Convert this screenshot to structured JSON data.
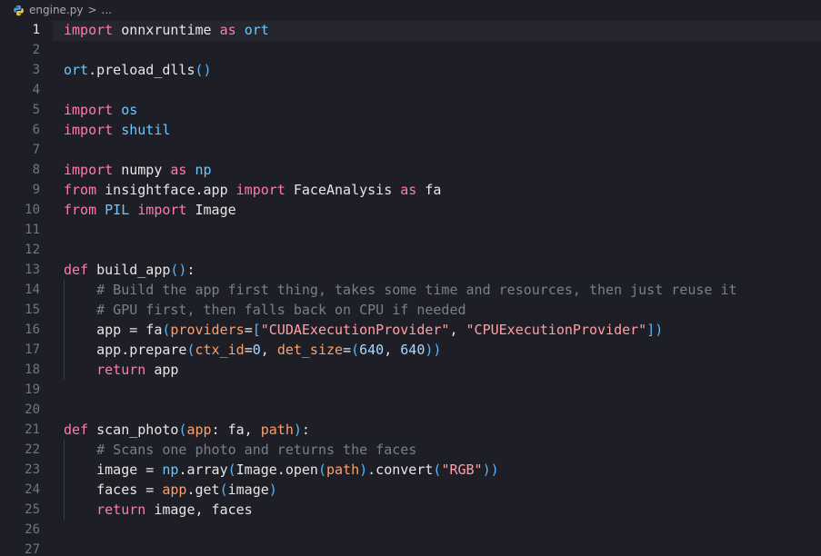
{
  "breadcrumb": {
    "file": "engine.py",
    "separator": ">",
    "more": "..."
  },
  "editor": {
    "active_line": 1,
    "lines": [
      {
        "n": "1",
        "tokens": [
          [
            "kw",
            "import"
          ],
          [
            "plain",
            " onnxruntime "
          ],
          [
            "kw",
            "as"
          ],
          [
            "plain",
            " "
          ],
          [
            "mod",
            "ort"
          ]
        ]
      },
      {
        "n": "2",
        "tokens": []
      },
      {
        "n": "3",
        "tokens": [
          [
            "mod",
            "ort"
          ],
          [
            "plain",
            ".preload_dlls"
          ],
          [
            "paren",
            "()"
          ]
        ]
      },
      {
        "n": "4",
        "tokens": []
      },
      {
        "n": "5",
        "tokens": [
          [
            "kw",
            "import"
          ],
          [
            "plain",
            " "
          ],
          [
            "mod",
            "os"
          ]
        ]
      },
      {
        "n": "6",
        "tokens": [
          [
            "kw",
            "import"
          ],
          [
            "plain",
            " "
          ],
          [
            "mod",
            "shutil"
          ]
        ]
      },
      {
        "n": "7",
        "tokens": []
      },
      {
        "n": "8",
        "tokens": [
          [
            "kw",
            "import"
          ],
          [
            "plain",
            " numpy "
          ],
          [
            "kw",
            "as"
          ],
          [
            "plain",
            " "
          ],
          [
            "mod",
            "np"
          ]
        ]
      },
      {
        "n": "9",
        "tokens": [
          [
            "kw",
            "from"
          ],
          [
            "plain",
            " insightface.app "
          ],
          [
            "kw",
            "import"
          ],
          [
            "plain",
            " FaceAnalysis "
          ],
          [
            "kw",
            "as"
          ],
          [
            "plain",
            " fa"
          ]
        ]
      },
      {
        "n": "10",
        "tokens": [
          [
            "kw",
            "from"
          ],
          [
            "plain",
            " "
          ],
          [
            "mod",
            "PIL"
          ],
          [
            "plain",
            " "
          ],
          [
            "kw",
            "import"
          ],
          [
            "plain",
            " Image"
          ]
        ]
      },
      {
        "n": "11",
        "tokens": []
      },
      {
        "n": "12",
        "tokens": []
      },
      {
        "n": "13",
        "tokens": [
          [
            "kw",
            "def"
          ],
          [
            "plain",
            " build_app"
          ],
          [
            "paren",
            "()"
          ],
          [
            "plain",
            ":"
          ]
        ]
      },
      {
        "n": "14",
        "tokens": [
          [
            "plain",
            "    "
          ],
          [
            "cmt",
            "# Build the app first thing, takes some time and resources, then just reuse it"
          ]
        ]
      },
      {
        "n": "15",
        "tokens": [
          [
            "plain",
            "    "
          ],
          [
            "cmt",
            "# GPU first, then falls back on CPU if needed"
          ]
        ]
      },
      {
        "n": "16",
        "tokens": [
          [
            "plain",
            "    app = fa"
          ],
          [
            "paren",
            "("
          ],
          [
            "param",
            "providers"
          ],
          [
            "plain",
            "="
          ],
          [
            "paren",
            "["
          ],
          [
            "str",
            "\"CUDAExecutionProvider\""
          ],
          [
            "plain",
            ", "
          ],
          [
            "str",
            "\"CPUExecutionProvider\""
          ],
          [
            "paren",
            "])"
          ]
        ]
      },
      {
        "n": "17",
        "tokens": [
          [
            "plain",
            "    app.prepare"
          ],
          [
            "paren",
            "("
          ],
          [
            "param",
            "ctx_id"
          ],
          [
            "plain",
            "="
          ],
          [
            "num",
            "0"
          ],
          [
            "plain",
            ", "
          ],
          [
            "param",
            "det_size"
          ],
          [
            "plain",
            "="
          ],
          [
            "paren",
            "("
          ],
          [
            "num",
            "640"
          ],
          [
            "plain",
            ", "
          ],
          [
            "num",
            "640"
          ],
          [
            "paren",
            "))"
          ]
        ]
      },
      {
        "n": "18",
        "tokens": [
          [
            "plain",
            "    "
          ],
          [
            "kw",
            "return"
          ],
          [
            "plain",
            " app"
          ]
        ]
      },
      {
        "n": "19",
        "tokens": []
      },
      {
        "n": "20",
        "tokens": []
      },
      {
        "n": "21",
        "tokens": [
          [
            "kw",
            "def"
          ],
          [
            "plain",
            " scan_photo"
          ],
          [
            "paren",
            "("
          ],
          [
            "param",
            "app"
          ],
          [
            "plain",
            ": fa, "
          ],
          [
            "param",
            "path"
          ],
          [
            "paren",
            ")"
          ],
          [
            "plain",
            ":"
          ]
        ]
      },
      {
        "n": "22",
        "tokens": [
          [
            "plain",
            "    "
          ],
          [
            "cmt",
            "# Scans one photo and returns the faces"
          ]
        ]
      },
      {
        "n": "23",
        "tokens": [
          [
            "plain",
            "    image = "
          ],
          [
            "mod",
            "np"
          ],
          [
            "plain",
            ".array"
          ],
          [
            "paren",
            "("
          ],
          [
            "plain",
            "Image.open"
          ],
          [
            "paren",
            "("
          ],
          [
            "param",
            "path"
          ],
          [
            "paren",
            ")"
          ],
          [
            "plain",
            ".convert"
          ],
          [
            "paren",
            "("
          ],
          [
            "str",
            "\"RGB\""
          ],
          [
            "paren",
            "))"
          ]
        ]
      },
      {
        "n": "24",
        "tokens": [
          [
            "plain",
            "    faces = "
          ],
          [
            "param",
            "app"
          ],
          [
            "plain",
            ".get"
          ],
          [
            "paren",
            "("
          ],
          [
            "plain",
            "image"
          ],
          [
            "paren",
            ")"
          ]
        ]
      },
      {
        "n": "25",
        "tokens": [
          [
            "plain",
            "    "
          ],
          [
            "kw",
            "return"
          ],
          [
            "plain",
            " image, faces"
          ]
        ]
      },
      {
        "n": "26",
        "tokens": []
      },
      {
        "n": "27",
        "tokens": []
      }
    ]
  },
  "colors": {
    "background": "#1e1f26",
    "keyword": "#ff7ab2",
    "module": "#6ac7ff",
    "string": "#ffa0a6",
    "number": "#a7d8ff",
    "parameter": "#ff9e6b",
    "comment": "#7b7f8b"
  }
}
